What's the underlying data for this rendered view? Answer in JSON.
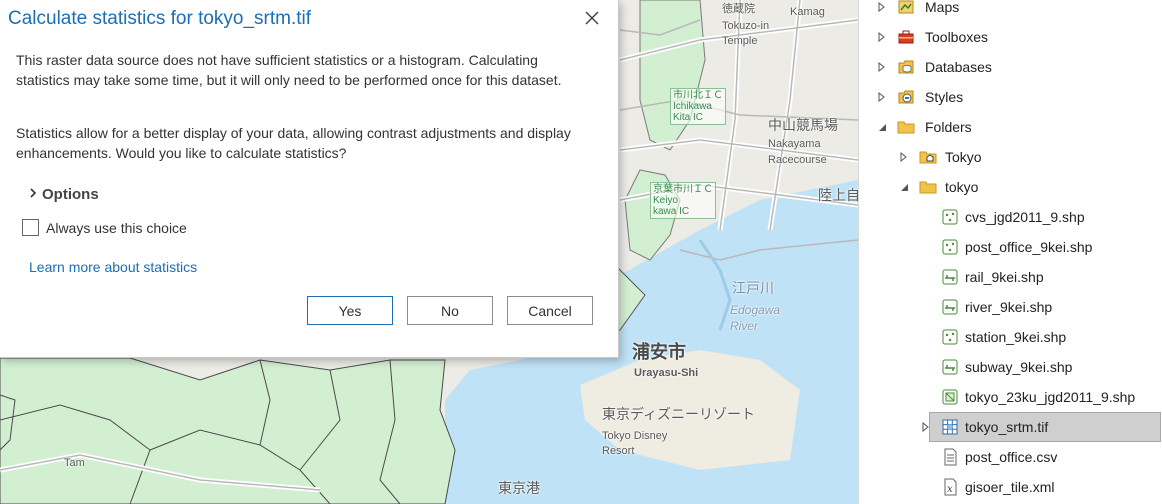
{
  "dialog": {
    "title": "Calculate statistics for tokyo_srtm.tif",
    "paragraph1": "This raster data source does not have sufficient statistics or a histogram. Calculating statistics may take some time, but it will only need to be performed once for this dataset.",
    "paragraph2": "Statistics allow for a better display of your data, allowing contrast adjustments and display enhancements. Would you like to calculate statistics?",
    "options_label": "Options",
    "always_use_label": "Always use this choice",
    "always_use_checked": false,
    "learn_more_label": "Learn more about statistics",
    "buttons": {
      "yes": "Yes",
      "no": "No",
      "cancel": "Cancel"
    }
  },
  "map": {
    "labels": {
      "kamag": "Kamag",
      "tokuzoin_jp": "徳蔵院",
      "tokuzoin_en1": "Tokuzo-in",
      "tokuzoin_en2": "Temple",
      "ichikawa_kita_ic": "市川北ＩＣ",
      "ichikawa_kita_ic_en1": "Ichikawa",
      "ichikawa_kita_ic_en2": "Kita IC",
      "nakayama_jp": "中山競馬場",
      "nakayama_en1": "Nakayama",
      "nakayama_en2": "Racecourse",
      "keiyo_ic": "京葉市川ＩＣ",
      "keiyo_en1": "Keiyo",
      "keiyo_en2": "kawa IC",
      "rikujo": "陸上自",
      "edogawa_jp": "江戸川",
      "edogawa_en1": "Edogawa",
      "edogawa_en2": "River",
      "urayasu_jp": "浦安市",
      "urayasu_en": "Urayasu-Shi",
      "disney_jp": "東京ディズニーリゾート",
      "disney_en1": "Tokyo Disney",
      "disney_en2": "Resort",
      "tama": "Tam",
      "tokyo_port": "東京港"
    }
  },
  "catalog": {
    "items": [
      {
        "label": "Maps",
        "icon": "maps-icon",
        "expander": "collapsed"
      },
      {
        "label": "Toolboxes",
        "icon": "toolbox-icon",
        "expander": "collapsed"
      },
      {
        "label": "Databases",
        "icon": "database-icon",
        "expander": "collapsed"
      },
      {
        "label": "Styles",
        "icon": "styles-icon",
        "expander": "collapsed"
      },
      {
        "label": "Folders",
        "icon": "folder-icon",
        "expander": "expanded"
      },
      {
        "label": "Tokyo",
        "icon": "home-folder-icon",
        "expander": "collapsed"
      },
      {
        "label": "tokyo",
        "icon": "folder-icon",
        "expander": "expanded"
      },
      {
        "label": "cvs_jgd2011_9.shp",
        "icon": "point-shapefile-icon",
        "expander": "none"
      },
      {
        "label": "post_office_9kei.shp",
        "icon": "point-shapefile-icon",
        "expander": "none"
      },
      {
        "label": "rail_9kei.shp",
        "icon": "line-shapefile-icon",
        "expander": "none"
      },
      {
        "label": "river_9kei.shp",
        "icon": "line-shapefile-icon",
        "expander": "none"
      },
      {
        "label": "station_9kei.shp",
        "icon": "point-shapefile-icon",
        "expander": "none"
      },
      {
        "label": "subway_9kei.shp",
        "icon": "line-shapefile-icon",
        "expander": "none"
      },
      {
        "label": "tokyo_23ku_jgd2011_9.shp",
        "icon": "polygon-shapefile-icon",
        "expander": "none"
      },
      {
        "label": "tokyo_srtm.tif",
        "icon": "raster-icon",
        "expander": "collapsed",
        "selected": true
      },
      {
        "label": "post_office.csv",
        "icon": "csv-file-icon",
        "expander": "none"
      },
      {
        "label": "gisoer_tile.xml",
        "icon": "xml-file-icon",
        "expander": "none"
      }
    ]
  },
  "colors": {
    "accent": "#1a6fb5",
    "map_green": "#d3efd2",
    "map_water": "#bfe2f6",
    "selected_row": "#cfcfcf"
  }
}
